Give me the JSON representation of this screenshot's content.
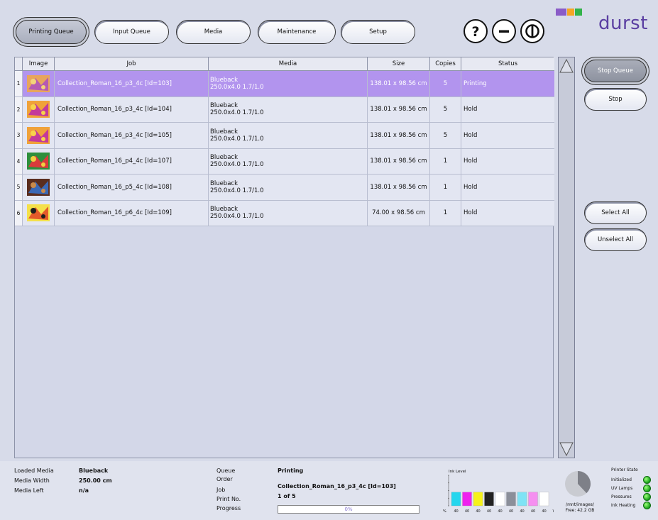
{
  "nav": {
    "tabs": [
      {
        "label": "Printing Queue",
        "active": true
      },
      {
        "label": "Input Queue",
        "active": false
      },
      {
        "label": "Media",
        "active": false
      },
      {
        "label": "Maintenance",
        "active": false
      },
      {
        "label": "Setup",
        "active": false
      }
    ],
    "icons": [
      "help-icon",
      "minimize-icon",
      "power-icon"
    ]
  },
  "brand": {
    "name": "durst",
    "logo_colors": [
      "#8a5cc7",
      "#f5a623",
      "#33b34a"
    ]
  },
  "table": {
    "headers": [
      "",
      "Image",
      "Job",
      "Media",
      "Size",
      "Copies",
      "Status"
    ],
    "rows": [
      {
        "num": "1",
        "job": "Collection_Roman_16_p3_4c [Id=103]",
        "media_name": "Blueback",
        "media_spec": "250.0x4.0 1.7/1.0",
        "size": "138.01 x 98.56 cm",
        "copies": "5",
        "status": "Printing",
        "selected": true,
        "thumb_colors": [
          "#e8a55c",
          "#b65ab3",
          "#f3d47a"
        ]
      },
      {
        "num": "2",
        "job": "Collection_Roman_16_p3_4c [Id=104]",
        "media_name": "Blueback",
        "media_spec": "250.0x4.0 1.7/1.0",
        "size": "138.01 x 98.56 cm",
        "copies": "5",
        "status": "Hold",
        "selected": false,
        "thumb_colors": [
          "#f0a23a",
          "#c43a9a",
          "#f7d24b"
        ]
      },
      {
        "num": "3",
        "job": "Collection_Roman_16_p3_4c [Id=105]",
        "media_name": "Blueback",
        "media_spec": "250.0x4.0 1.7/1.0",
        "size": "138.01 x 98.56 cm",
        "copies": "5",
        "status": "Hold",
        "selected": false,
        "thumb_colors": [
          "#f0a23a",
          "#c43a9a",
          "#f7d24b"
        ]
      },
      {
        "num": "4",
        "job": "Collection_Roman_16_p4_4c [Id=107]",
        "media_name": "Blueback",
        "media_spec": "250.0x4.0 1.7/1.0",
        "size": "138.01 x 98.56 cm",
        "copies": "1",
        "status": "Hold",
        "selected": false,
        "thumb_colors": [
          "#2e8f3c",
          "#d93b3b",
          "#f0d040"
        ]
      },
      {
        "num": "5",
        "job": "Collection_Roman_16_p5_4c [Id=108]",
        "media_name": "Blueback",
        "media_spec": "250.0x4.0 1.7/1.0",
        "size": "138.01 x 98.56 cm",
        "copies": "1",
        "status": "Hold",
        "selected": false,
        "thumb_colors": [
          "#5a2d1e",
          "#3a68b5",
          "#c98a4a"
        ]
      },
      {
        "num": "6",
        "job": "Collection_Roman_16_p6_4c [Id=109]",
        "media_name": "Blueback",
        "media_spec": "250.0x4.0 1.7/1.0",
        "size": "74.00 x 98.56 cm",
        "copies": "1",
        "status": "Hold",
        "selected": false,
        "thumb_colors": [
          "#f4e04a",
          "#e45a2a",
          "#1f1f1f"
        ]
      }
    ]
  },
  "side_buttons": {
    "stop_queue": "Stop Queue",
    "stop": "Stop",
    "select_all": "Select All",
    "unselect_all": "Unselect All"
  },
  "status": {
    "loaded_media_label": "Loaded Media",
    "loaded_media_value": "Blueback",
    "media_width_label": "Media Width",
    "media_width_value": "250.00 cm",
    "media_left_label": "Media Left",
    "media_left_value": "n/a",
    "queue_label": "Queue",
    "queue_value": "Printing",
    "order_label": "Order",
    "job_label": "Job",
    "job_value": "Collection_Roman_16_p3_4c [Id=103]",
    "print_no_label": "Print No.",
    "print_no_value": "1 of 5",
    "progress_label": "Progress",
    "progress_value": "0%",
    "progress_fraction": 0.0
  },
  "ink": {
    "title": "Ink Level",
    "unit_label": "%",
    "columns": [
      {
        "label": "40",
        "color": "#25d6ee",
        "level": 0.45
      },
      {
        "label": "40",
        "color": "#ee22ee",
        "level": 0.45
      },
      {
        "label": "40",
        "color": "#f6f21a",
        "level": 0.45
      },
      {
        "label": "40",
        "color": "#222222",
        "level": 0.45
      },
      {
        "label": "40",
        "color": "#ffffff",
        "level": 0.45
      },
      {
        "label": "40",
        "color": "#8b8f9a",
        "level": 0.45
      },
      {
        "label": "40",
        "color": "#7fe3f5",
        "level": 0.45
      },
      {
        "label": "40",
        "color": "#f58ff0",
        "level": 0.45
      },
      {
        "label": "40",
        "color": "#ffffff",
        "level": 0.45
      }
    ],
    "last_label": "W"
  },
  "disk": {
    "path": "/mnt/images/",
    "free": "Free: 42.2 GB",
    "used_fraction": 0.38
  },
  "printer_state": {
    "title": "Printer State",
    "items": [
      "Initialized",
      "UV Lamps",
      "Pressures",
      "Ink Heating"
    ]
  }
}
